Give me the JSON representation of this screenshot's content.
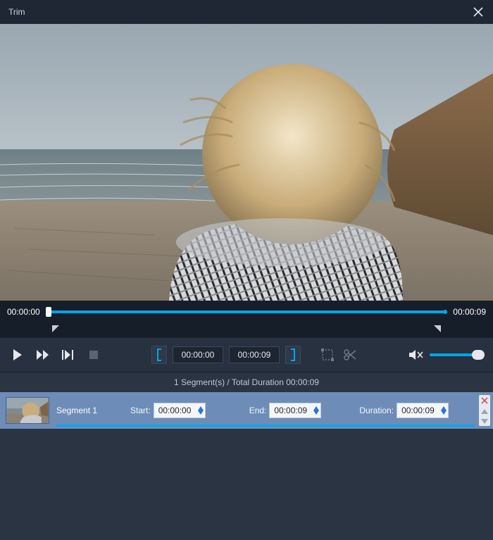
{
  "title": "Trim",
  "icons": {
    "close": "close-icon",
    "mute": "volume-mute-icon"
  },
  "preview": {
    "currentTime": "00:00:00",
    "totalTime": "00:00:09"
  },
  "controls": {
    "startTimeField": "00:00:00",
    "endTimeField": "00:00:09"
  },
  "summary": "1 Segment(s) / Total Duration 00:00:09",
  "segment": {
    "name": "Segment 1",
    "labels": {
      "start": "Start:",
      "end": "End:",
      "duration": "Duration:"
    },
    "start": "00:00:00",
    "end": "00:00:09",
    "duration": "00:00:09"
  }
}
